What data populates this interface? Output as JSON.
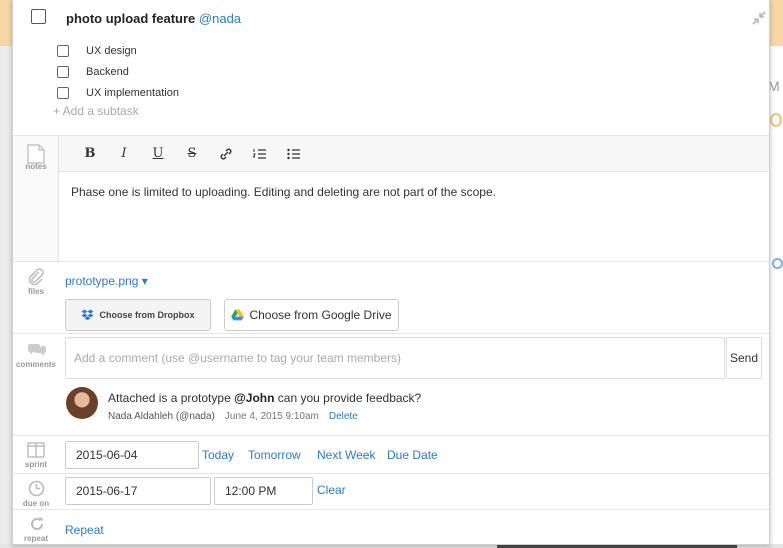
{
  "task": {
    "title": "photo upload feature",
    "mention": "@nada",
    "subtasks": [
      {
        "label": "UX design"
      },
      {
        "label": "Backend"
      },
      {
        "label": "UX implementation"
      }
    ],
    "add_subtask": "+ Add a subtask"
  },
  "notes": {
    "label": "notes",
    "toolbar": {
      "bold": "B",
      "italic": "I",
      "underline": "U",
      "strike": "S"
    },
    "text": "Phase one is limited to uploading. Editing and deleting are not part of the scope."
  },
  "files": {
    "label": "files",
    "file_name": "prototype.png ▾",
    "dropbox_label": "Choose from Dropbox",
    "gdrive_label": "Choose from Google Drive"
  },
  "comments": {
    "label": "comments",
    "placeholder": "Add a comment (use @username to tag your team members)",
    "send_label": "Send",
    "items": [
      {
        "text_before": "Attached is a prototype ",
        "mention": "@John",
        "text_after": " can you provide feedback?",
        "author": "Nada Aldahleh (@nada)",
        "date": "June 4, 2015 9:10am",
        "delete_label": "Delete"
      }
    ]
  },
  "sprint": {
    "label": "sprint",
    "date": "2015-06-04",
    "today": "Today",
    "tomorrow": "Tomorrow",
    "next_week": "Next Week",
    "due_date": "Due Date"
  },
  "due": {
    "label": "due on",
    "date": "2015-06-17",
    "time": "12:00 PM",
    "clear": "Clear"
  },
  "repeat": {
    "label": "repeat",
    "link": "Repeat"
  },
  "background": {
    "m_letter": "M"
  },
  "colors": {
    "link": "#2a7bd1",
    "header_band": "#f8d7a6"
  }
}
